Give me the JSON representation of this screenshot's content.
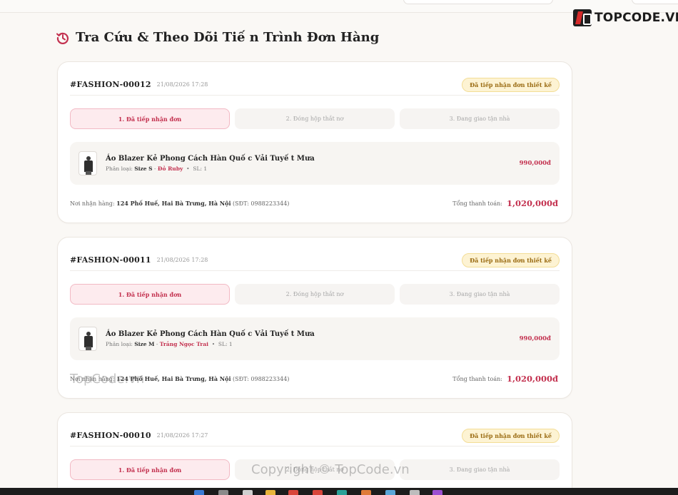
{
  "brand": {
    "name": "TOPCODE.VN"
  },
  "page": {
    "title": "Tra Cứu & Theo Dõi Tiế n Trình Đơn Hàng"
  },
  "orders": [
    {
      "id": "#FASHION-00012",
      "date": "21/08/2026 17:28",
      "status": "Đã tiếp nhận đơn thiết kế",
      "steps": [
        "1. Đã tiếp nhận đơn",
        "2. Đóng hộp thắt nơ",
        "3. Đang giao tận nhà"
      ],
      "item": {
        "name": "Áo Blazer Kẻ Phong Cách Hàn Quố c Vải Tuyế t Mưa",
        "variant_label": "Phân loại:",
        "size": "Size S",
        "color": "Đỏ Ruby",
        "qty": "SL: 1",
        "price": "990,000đ"
      },
      "address_label": "Nơi nhận hàng:",
      "address": "124 Phố Huế, Hai Bà Trưng, Hà Nội",
      "phone": "(SĐT: 0988223344)",
      "total_label": "Tổng thanh toán:",
      "total": "1,020,000đ"
    },
    {
      "id": "#FASHION-00011",
      "date": "21/08/2026 17:28",
      "status": "Đã tiếp nhận đơn thiết kế",
      "steps": [
        "1. Đã tiếp nhận đơn",
        "2. Đóng hộp thắt nơ",
        "3. Đang giao tận nhà"
      ],
      "item": {
        "name": "Áo Blazer Kẻ Phong Cách Hàn Quố c Vải Tuyế t Mưa",
        "variant_label": "Phân loại:",
        "size": "Size M",
        "color": "Trắng Ngọc Trai",
        "qty": "SL: 1",
        "price": "990,000đ"
      },
      "address_label": "Nơi nhận hàng:",
      "address": "124 Phố Huế, Hai Bà Trưng, Hà Nội",
      "phone": "(SĐT: 0988223344)",
      "total_label": "Tổng thanh toán:",
      "total": "1,020,000đ"
    },
    {
      "id": "#FASHION-00010",
      "date": "21/08/2026 17:27",
      "status": "Đã tiếp nhận đơn thiết kế",
      "steps": [
        "1. Đã tiếp nhận đơn",
        "2. Đóng hộp thắt nơ",
        "3. Đang giao tận nhà"
      ]
    }
  ],
  "watermarks": {
    "mid": "TopCode.vn",
    "bottom": "Copyright © TopCode.vn"
  },
  "colors": {
    "accent": "#c3314f",
    "badge_bg": "#fdf3d3",
    "badge_text": "#9a6b12",
    "page_bg": "#faf8f5"
  }
}
